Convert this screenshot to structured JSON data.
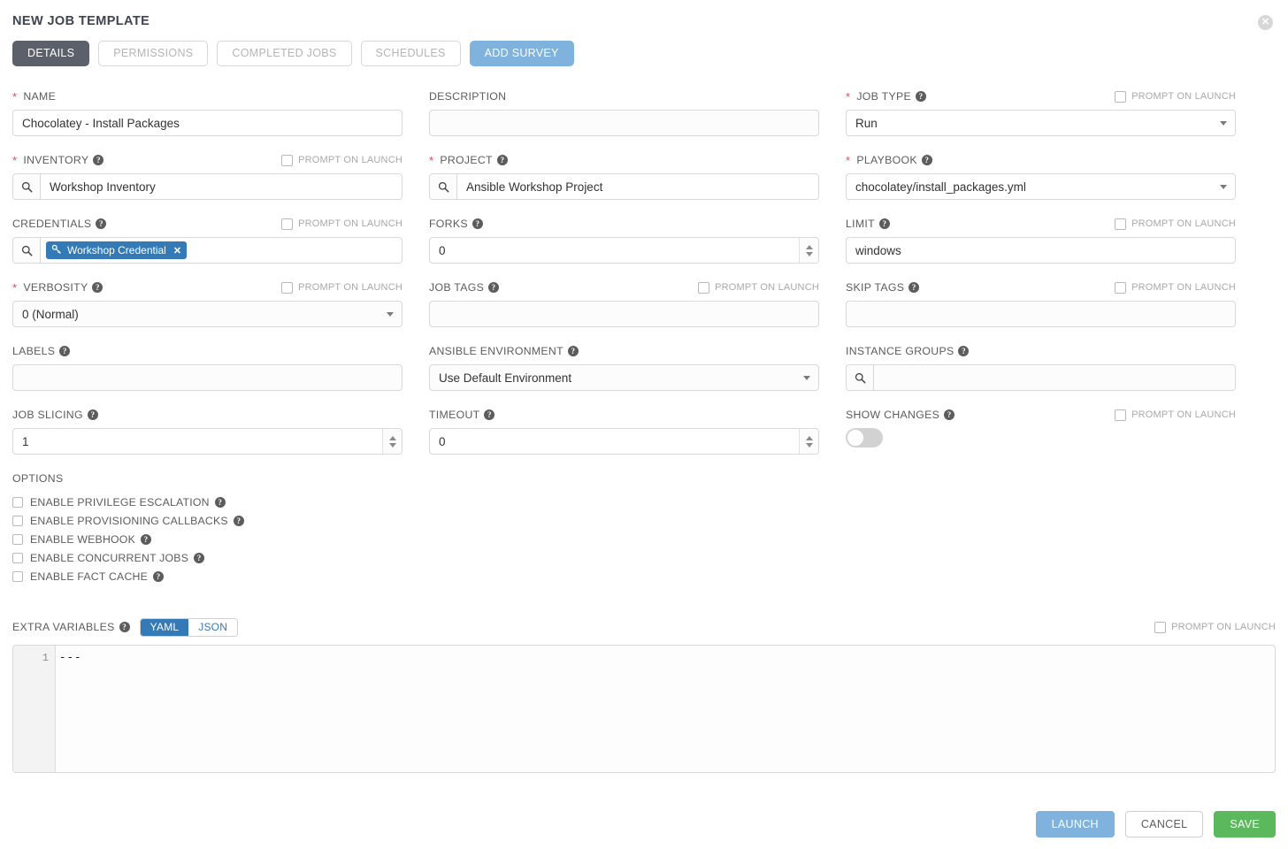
{
  "header": {
    "title": "NEW JOB TEMPLATE",
    "close_icon": "close-icon"
  },
  "tabs": [
    {
      "label": "DETAILS",
      "state": "active"
    },
    {
      "label": "PERMISSIONS",
      "state": "disabled"
    },
    {
      "label": "COMPLETED JOBS",
      "state": "disabled"
    },
    {
      "label": "SCHEDULES",
      "state": "disabled"
    },
    {
      "label": "ADD SURVEY",
      "state": "primary"
    }
  ],
  "prompt_on_launch_label": "PROMPT ON LAUNCH",
  "fields": {
    "name": {
      "label": "NAME",
      "required": true,
      "value": "Chocolatey - Install Packages"
    },
    "description": {
      "label": "DESCRIPTION",
      "value": ""
    },
    "job_type": {
      "label": "JOB TYPE",
      "required": true,
      "value": "Run"
    },
    "inventory": {
      "label": "INVENTORY",
      "required": true,
      "value": "Workshop Inventory"
    },
    "project": {
      "label": "PROJECT",
      "required": true,
      "value": "Ansible Workshop Project"
    },
    "playbook": {
      "label": "PLAYBOOK",
      "required": true,
      "value": "chocolatey/install_packages.yml"
    },
    "credentials": {
      "label": "CREDENTIALS",
      "chip": "Workshop Credential"
    },
    "forks": {
      "label": "FORKS",
      "value": "0"
    },
    "limit": {
      "label": "LIMIT",
      "value": "windows"
    },
    "verbosity": {
      "label": "VERBOSITY",
      "required": true,
      "value": "0 (Normal)"
    },
    "job_tags": {
      "label": "JOB TAGS",
      "value": ""
    },
    "skip_tags": {
      "label": "SKIP TAGS",
      "value": ""
    },
    "labels": {
      "label": "LABELS",
      "value": ""
    },
    "ansible_environment": {
      "label": "ANSIBLE ENVIRONMENT",
      "value": "Use Default Environment"
    },
    "instance_groups": {
      "label": "INSTANCE GROUPS",
      "value": ""
    },
    "job_slicing": {
      "label": "JOB SLICING",
      "value": "1"
    },
    "timeout": {
      "label": "TIMEOUT",
      "value": "0"
    },
    "show_changes": {
      "label": "SHOW CHANGES",
      "value": "off"
    }
  },
  "options": {
    "title": "OPTIONS",
    "items": [
      {
        "label": "ENABLE PRIVILEGE ESCALATION",
        "checked": false
      },
      {
        "label": "ENABLE PROVISIONING CALLBACKS",
        "checked": false
      },
      {
        "label": "ENABLE WEBHOOK",
        "checked": false
      },
      {
        "label": "ENABLE CONCURRENT JOBS",
        "checked": false
      },
      {
        "label": "ENABLE FACT CACHE",
        "checked": false
      }
    ]
  },
  "extra_variables": {
    "label": "EXTRA VARIABLES",
    "format_yaml": "YAML",
    "format_json": "JSON",
    "selected_format": "YAML",
    "line_number": "1",
    "content": "---"
  },
  "footer": {
    "launch": "LAUNCH",
    "cancel": "CANCEL",
    "save": "SAVE"
  },
  "colors": {
    "accent_blue": "#337ab7",
    "light_blue": "#7fb2dd",
    "active_tab": "#5b606b",
    "save_green": "#5cb85c",
    "required_red": "#d9534f"
  }
}
